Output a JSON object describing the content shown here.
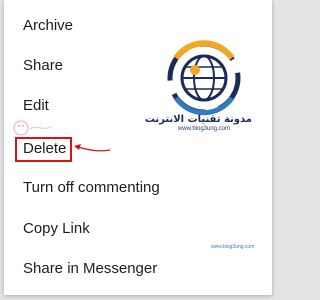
{
  "menu": {
    "items": [
      {
        "label": "Archive"
      },
      {
        "label": "Share"
      },
      {
        "label": "Edit"
      },
      {
        "label": "Delete"
      },
      {
        "label": "Turn off commenting"
      },
      {
        "label": "Copy Link"
      },
      {
        "label": "Share in Messenger"
      }
    ]
  },
  "watermark": {
    "brand_arabic": "مدونة تقنيات الانترنت",
    "url": "www.blog3ung.com",
    "url_repeat": "www.blog3ung.com"
  },
  "colors": {
    "highlight": "#d5141a",
    "logo_navy": "#1b2a57",
    "logo_orange": "#f5a623",
    "logo_blue": "#2e7dbf"
  },
  "icons": [
    "globe-logo-icon",
    "annotation-arrow-icon",
    "ghost-watermark-icon"
  ]
}
